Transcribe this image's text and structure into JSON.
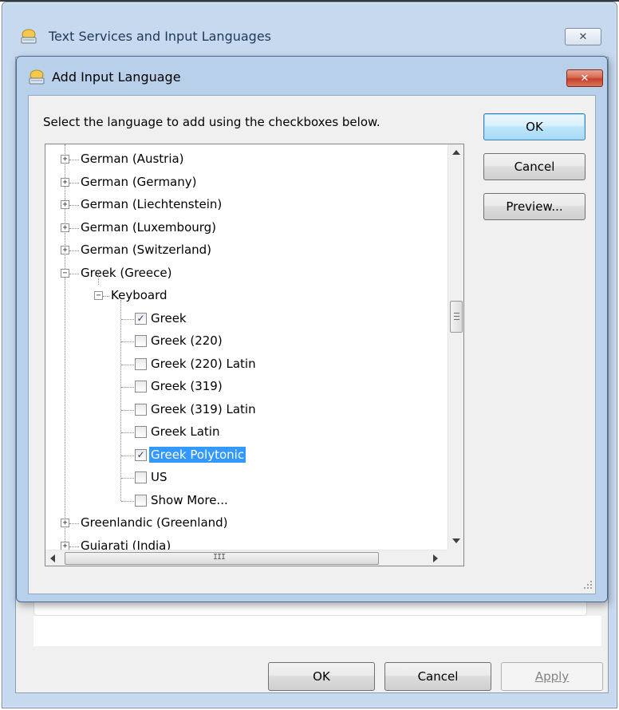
{
  "outer_window": {
    "title": "Text Services and Input Languages",
    "close_glyph": "✕",
    "buttons": {
      "ok": "OK",
      "cancel": "Cancel",
      "apply": "Apply"
    }
  },
  "dialog": {
    "title": "Add Input Language",
    "close_glyph": "✕",
    "instruction": "Select the language to add using the checkboxes below.",
    "buttons": {
      "ok": "OK",
      "cancel": "Cancel",
      "preview": "Preview..."
    }
  },
  "tree": {
    "languages_before": [
      {
        "label": "German (Austria)",
        "expander": "+"
      },
      {
        "label": "German (Germany)",
        "expander": "+"
      },
      {
        "label": "German (Liechtenstein)",
        "expander": "+"
      },
      {
        "label": "German (Luxembourg)",
        "expander": "+"
      },
      {
        "label": "German (Switzerland)",
        "expander": "+"
      },
      {
        "label": "Greek (Greece)",
        "expander": "−"
      }
    ],
    "keyboard_node": {
      "label": "Keyboard",
      "expander": "−"
    },
    "keyboards": [
      {
        "label": "Greek",
        "checked": true,
        "selected": false
      },
      {
        "label": "Greek (220)",
        "checked": false,
        "selected": false
      },
      {
        "label": "Greek (220) Latin",
        "checked": false,
        "selected": false
      },
      {
        "label": "Greek (319)",
        "checked": false,
        "selected": false
      },
      {
        "label": "Greek (319) Latin",
        "checked": false,
        "selected": false
      },
      {
        "label": "Greek Latin",
        "checked": false,
        "selected": false
      },
      {
        "label": "Greek Polytonic",
        "checked": true,
        "selected": true
      },
      {
        "label": "US",
        "checked": false,
        "selected": false
      },
      {
        "label": "Show More...",
        "checked": false,
        "selected": false
      }
    ],
    "languages_after": [
      {
        "label": "Greenlandic (Greenland)",
        "expander": "+"
      },
      {
        "label": "Gujarati (India)",
        "expander": "+"
      }
    ],
    "check_glyph": "✓",
    "hscroll_grip": "III"
  },
  "colors": {
    "selection": "#3399ff",
    "dialog_frame": "#b8d0ea",
    "close_red": "#c7402a"
  },
  "icons": {
    "window_icon": "keyboard-globe-icon",
    "scroll_up": "arrow-up-icon",
    "scroll_down": "arrow-down-icon",
    "scroll_left": "arrow-left-icon",
    "scroll_right": "arrow-right-icon"
  }
}
